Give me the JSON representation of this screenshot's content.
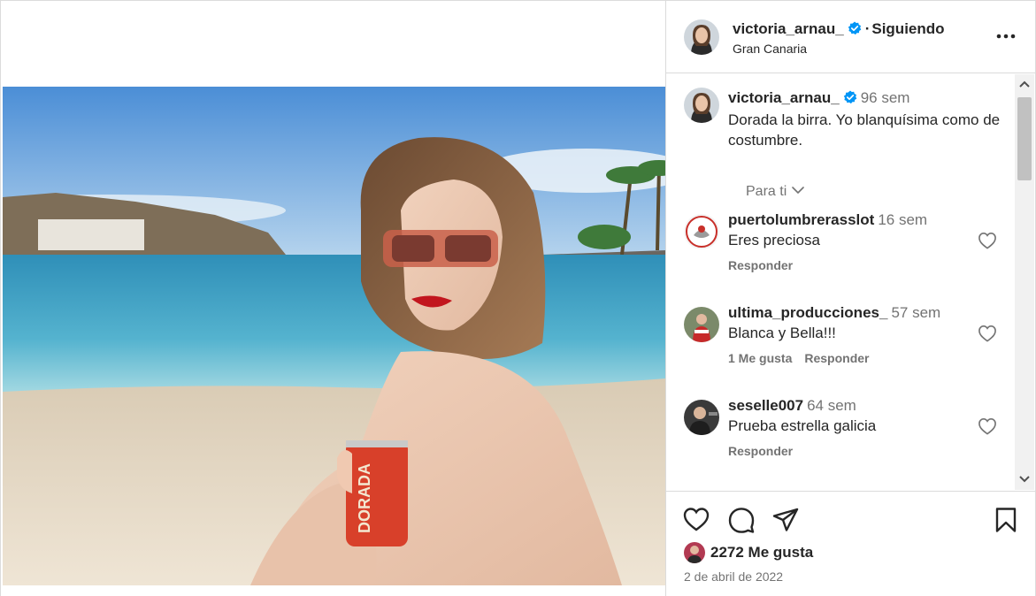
{
  "post": {
    "author": "victoria_arnau_",
    "follow_status": "Siguiendo",
    "separator": "·",
    "location": "Gran Canaria",
    "caption": {
      "username": "victoria_arnau_",
      "time": "96 sem",
      "text": "Dorada la birra. Yo blanquísima como de costumbre."
    },
    "filter_label": "Para ti",
    "likes_text": "2272 Me gusta",
    "date": "2 de abril de 2022",
    "photo_can_text": "DORADA"
  },
  "comments": [
    {
      "username": "puertolumbrerasslot",
      "time": "16 sem",
      "text": "Eres preciosa",
      "likes": "",
      "reply": "Responder"
    },
    {
      "username": "ultima_producciones_",
      "time": "57 sem",
      "text": "Blanca y Bella!!!",
      "likes": "1 Me gusta",
      "reply": "Responder"
    },
    {
      "username": "seselle007",
      "time": "64 sem",
      "text": "Prueba estrella galicia",
      "likes": "",
      "reply": "Responder"
    }
  ],
  "icons": {
    "more": "more-options-icon",
    "verified": "verified-badge-icon",
    "heart": "heart-icon",
    "comment": "comment-icon",
    "share": "share-icon",
    "save": "bookmark-icon"
  },
  "colors": {
    "verified_blue": "#0095f6",
    "text_primary": "#262626",
    "text_secondary": "#737373",
    "border": "#dbdbdb"
  }
}
